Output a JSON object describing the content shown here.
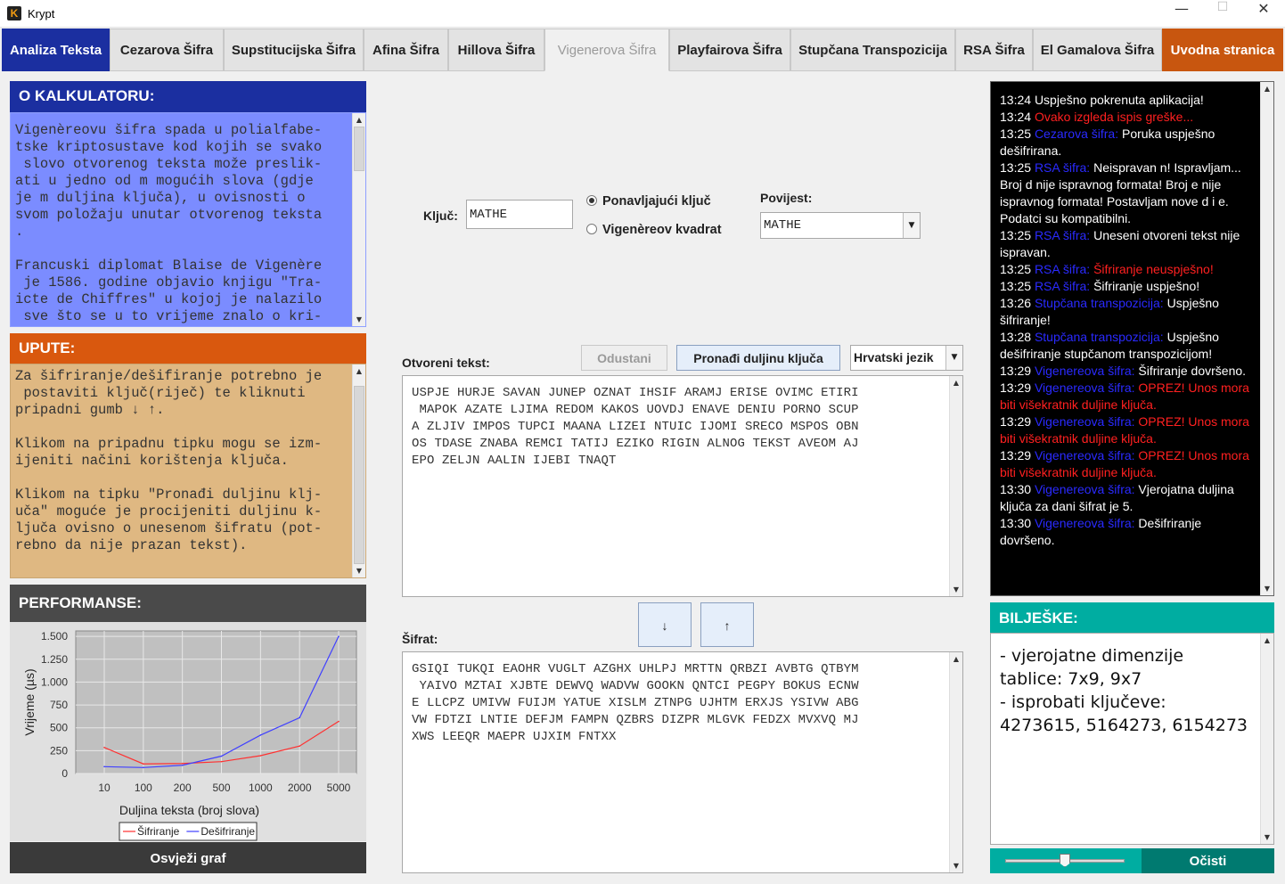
{
  "window": {
    "title": "Krypt",
    "icon_letter": "K",
    "min": "—",
    "max": "☐",
    "close": "✕"
  },
  "tabs": [
    "Analiza Teksta",
    "Cezarova Šifra",
    "Supstitucijska Šifra",
    "Afina Šifra",
    "Hillova Šifra",
    "Vigenerova Šifra",
    "Playfairova Šifra",
    "Stupčana Transpozicija",
    "RSA Šifra",
    "El Gamalova Šifra",
    "Uvodna stranica"
  ],
  "about": {
    "title": "O KALKULATORU:",
    "text": "Vigenèreovu šifra spada u polialfabe-\ntske kriptosustave kod kojih se svako\n slovo otvorenog teksta može preslik-\nati u jedno od m mogućih slova (gdje\nje m duljina ključa), u ovisnosti o\nsvom položaju unutar otvorenog teksta\n.\n\nFrancuski diplomat Blaise de Vigenère\n je 1586. godine objavio knjigu \"Tra-\nicte de Chiffres\" u kojoj je nalazilo\n sve što se u to vrijeme znalo o kri-"
  },
  "instructions": {
    "title": "UPUTE:",
    "text": "Za šifriranje/dešifiranje potrebno je\n postaviti ključ(riječ) te kliknuti\npripadni gumb ↓ ↑.\n\nKlikom na pripadnu tipku mogu se izm-\nijeniti načini korištenja ključa.\n\nKlikom na tipku \"Pronađi duljinu klj-\nuča\" moguće je procijeniti duljinu k-\nljuča ovisno o unesenom šifratu (pot-\nrebno da nije prazan tekst)."
  },
  "performance": {
    "title": "PERFORMANSE:",
    "refresh_label": "Osvježi graf"
  },
  "chart_data": {
    "type": "line",
    "categories": [
      "10",
      "100",
      "200",
      "500",
      "1000",
      "2000",
      "5000"
    ],
    "series": [
      {
        "name": "Šifriranje",
        "color": "#ff3030",
        "values": [
          285,
          105,
          110,
          130,
          195,
          300,
          570
        ]
      },
      {
        "name": "Dešifriranje",
        "color": "#4040ff",
        "values": [
          75,
          65,
          90,
          190,
          420,
          610,
          1500
        ]
      }
    ],
    "xlabel": "Duljina teksta (broj slova)",
    "ylabel": "Vrijeme (µs)",
    "yticks": [
      "0",
      "250",
      "500",
      "750",
      "1.000",
      "1.250",
      "1.500"
    ],
    "ylim": [
      0,
      1560
    ],
    "grid": true,
    "legend": "bottom"
  },
  "key": {
    "label": "Ključ:",
    "value": "MATHE",
    "radio_repeat": "Ponavljajući ključ",
    "radio_square": "Vigenèreov kvadrat",
    "history_label": "Povijest:",
    "history_value": "MATHE"
  },
  "plaintext": {
    "label": "Otvoreni tekst:",
    "cancel_label": "Odustani",
    "find_key_label": "Pronađi duljinu ključa",
    "language": "Hrvatski jezik",
    "text": "USPJE HURJE SAVAN JUNEP OZNAT IHSIF ARAMJ ERISE OVIMC ETIRI\n MAPOK AZATE LJIMA REDOM KAKOS UOVDJ ENAVE DENIU PORNO SCUP\nA ZLJIV IMPOS TUPCI MAANA LIZEI NTUIC IJOMI SRECO MSPOS OBN\nOS TDASE ZNABA REMCI TATIJ EZIKO RIGIN ALNOG TEKST AVEOM AJ\nEPO ZELJN AALIN IJEBI TNAQT"
  },
  "arrows": {
    "down": "↓",
    "up": "↑"
  },
  "ciphertext": {
    "label": "Šifrat:",
    "text": "GSIQI TUKQI EAOHR VUGLT AZGHX UHLPJ MRTTN QRBZI AVBTG QTBYM\n YAIVO MZTAI XJBTE DEWVQ WADVW GOOKN QNTCI PEGPY BOKUS ECNW\nE LLCPZ UMIVW FUIJM YATUE XISLM ZTNPG UJHTM ERXJS YSIVW ABG\nVW FDTZI LNTIE DEFJM FAMPN QZBRS DIZPR MLGVK FEDZX MVXVQ MJ\nXWS LEEQR MAEPR UJXIM FNTXX"
  },
  "log": [
    [
      [
        "13:24 ",
        "t"
      ],
      [
        "Uspješno pokrenuta aplikacija!",
        "t"
      ]
    ],
    [
      [
        "13:24 ",
        "t"
      ],
      [
        "Ovako izgleda ispis greške...",
        "e"
      ]
    ],
    [
      [
        "13:25 ",
        "t"
      ],
      [
        "Cezarova šifra: ",
        "s"
      ],
      [
        "Poruka uspješno dešifrirana.",
        "t"
      ]
    ],
    [
      [
        "13:25 ",
        "t"
      ],
      [
        "RSA šifra: ",
        "s"
      ],
      [
        "Neispravan n! Ispravljam... Broj d nije ispravnog formata! Broj e nije ispravnog formata! Postavljam nove d i e. Podatci su kompatibilni.",
        "t"
      ]
    ],
    [
      [
        "13:25 ",
        "t"
      ],
      [
        "RSA šifra: ",
        "s"
      ],
      [
        "Uneseni otvoreni tekst nije ispravan.",
        "t"
      ]
    ],
    [
      [
        "13:25 ",
        "t"
      ],
      [
        "RSA šifra: ",
        "s"
      ],
      [
        "Šifriranje neuspješno!",
        "e"
      ]
    ],
    [
      [
        "13:25 ",
        "t"
      ],
      [
        "RSA šifra: ",
        "s"
      ],
      [
        "Šifriranje uspješno!",
        "t"
      ]
    ],
    [
      [
        "13:26 ",
        "t"
      ],
      [
        "Stupčana transpozicija: ",
        "s"
      ],
      [
        "Uspješno šifriranje!",
        "t"
      ]
    ],
    [
      [
        "13:28 ",
        "t"
      ],
      [
        "Stupčana transpozicija: ",
        "s"
      ],
      [
        "Uspješno dešifriranje stupčanom transpozicijom!",
        "t"
      ]
    ],
    [
      [
        "13:29 ",
        "t"
      ],
      [
        "Vigenereova šifra: ",
        "s"
      ],
      [
        "Šifriranje dovršeno.",
        "t"
      ]
    ],
    [
      [
        "13:29 ",
        "t"
      ],
      [
        "Vigenereova šifra: ",
        "s"
      ],
      [
        "OPREZ! Unos mora biti višekratnik duljine ključa.",
        "e"
      ]
    ],
    [
      [
        "13:29 ",
        "t"
      ],
      [
        "Vigenereova šifra: ",
        "s"
      ],
      [
        "OPREZ! Unos mora biti višekratnik duljine ključa.",
        "e"
      ]
    ],
    [
      [
        "13:29 ",
        "t"
      ],
      [
        "Vigenereova šifra: ",
        "s"
      ],
      [
        "OPREZ! Unos mora biti višekratnik duljine ključa.",
        "e"
      ]
    ],
    [
      [
        "13:30 ",
        "t"
      ],
      [
        "Vigenereova šifra: ",
        "s"
      ],
      [
        "Vjerojatna duljina ključa za dani šifrat je 5.",
        "t"
      ]
    ],
    [
      [
        "13:30 ",
        "t"
      ],
      [
        "Vigenereova šifra: ",
        "s"
      ],
      [
        "Dešifriranje dovršeno.",
        "t"
      ]
    ]
  ],
  "notes": {
    "title": "BILJEŠKE:",
    "text": "- vjerojatne dimenzije tablice: 7x9, 9x7\n- isprobati ključeve: 4273615, 5164273, 6154273",
    "clear_label": "Očisti",
    "font_slider_level": 0.5
  }
}
